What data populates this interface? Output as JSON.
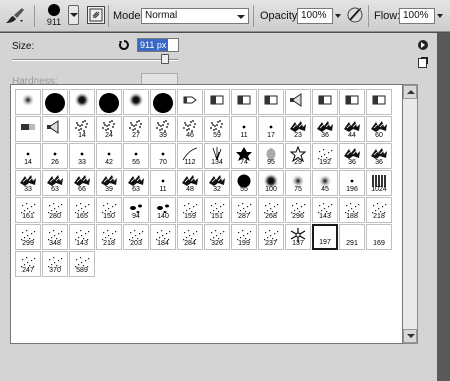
{
  "toolbar": {
    "brush_size": "911",
    "mode_label": "Mode:",
    "mode_value": "Normal",
    "opacity_label": "Opacity:",
    "opacity_value": "100%",
    "flow_label": "Flow:",
    "flow_value": "100%"
  },
  "panel": {
    "size_label": "Size:",
    "size_value": "911 px",
    "size_fraction": 0.92,
    "hardness_label": "Hardness:"
  },
  "brushes": [
    {
      "label": "",
      "glyph": "soft-dot-small"
    },
    {
      "label": "",
      "glyph": "hard-dot-large"
    },
    {
      "label": "",
      "glyph": "soft-dot-medium"
    },
    {
      "label": "",
      "glyph": "hard-dot-large"
    },
    {
      "label": "",
      "glyph": "soft-dot-medium"
    },
    {
      "label": "",
      "glyph": "hard-dot-large"
    },
    {
      "label": "",
      "glyph": "pencil-tip"
    },
    {
      "label": "",
      "glyph": "chisel-tip"
    },
    {
      "label": "",
      "glyph": "chisel-tip"
    },
    {
      "label": "",
      "glyph": "chisel-tip"
    },
    {
      "label": "",
      "glyph": "fan-tip"
    },
    {
      "label": "",
      "glyph": "chisel-tip"
    },
    {
      "label": "",
      "glyph": "chisel-tip"
    },
    {
      "label": "",
      "glyph": "chisel-tip"
    },
    {
      "label": "",
      "glyph": "chalk"
    },
    {
      "label": "",
      "glyph": "fan-tip"
    },
    {
      "label": "14",
      "glyph": "spray"
    },
    {
      "label": "24",
      "glyph": "spray"
    },
    {
      "label": "27",
      "glyph": "spray"
    },
    {
      "label": "39",
      "glyph": "spray"
    },
    {
      "label": "46",
      "glyph": "spray"
    },
    {
      "label": "59",
      "glyph": "spray"
    },
    {
      "label": "11",
      "glyph": "speck"
    },
    {
      "label": "17",
      "glyph": "speck"
    },
    {
      "label": "23",
      "glyph": "texture"
    },
    {
      "label": "36",
      "glyph": "texture"
    },
    {
      "label": "44",
      "glyph": "texture"
    },
    {
      "label": "60",
      "glyph": "texture"
    },
    {
      "label": "14",
      "glyph": "speck"
    },
    {
      "label": "26",
      "glyph": "speck"
    },
    {
      "label": "33",
      "glyph": "speck"
    },
    {
      "label": "42",
      "glyph": "speck"
    },
    {
      "label": "55",
      "glyph": "speck"
    },
    {
      "label": "70",
      "glyph": "speck"
    },
    {
      "label": "112",
      "glyph": "hairline"
    },
    {
      "label": "134",
      "glyph": "grass"
    },
    {
      "label": "74",
      "glyph": "leaf"
    },
    {
      "label": "95",
      "glyph": "leaf-gray"
    },
    {
      "label": "29",
      "glyph": "star"
    },
    {
      "label": "192",
      "glyph": "scatter"
    },
    {
      "label": "36",
      "glyph": "texture"
    },
    {
      "label": "36",
      "glyph": "texture"
    },
    {
      "label": "33",
      "glyph": "texture"
    },
    {
      "label": "63",
      "glyph": "texture"
    },
    {
      "label": "66",
      "glyph": "texture"
    },
    {
      "label": "39",
      "glyph": "texture"
    },
    {
      "label": "63",
      "glyph": "texture"
    },
    {
      "label": "11",
      "glyph": "speck"
    },
    {
      "label": "48",
      "glyph": "texture"
    },
    {
      "label": "32",
      "glyph": "texture"
    },
    {
      "label": "55",
      "glyph": "hard-dot-medium"
    },
    {
      "label": "100",
      "glyph": "soft-dot-medium"
    },
    {
      "label": "75",
      "glyph": "soft-dot-small"
    },
    {
      "label": "45",
      "glyph": "soft-dot-small"
    },
    {
      "label": "196",
      "glyph": "speck"
    },
    {
      "label": "1024",
      "glyph": "bristles"
    },
    {
      "label": "161",
      "glyph": "scatter"
    },
    {
      "label": "280",
      "glyph": "scatter"
    },
    {
      "label": "165",
      "glyph": "scatter"
    },
    {
      "label": "150",
      "glyph": "scatter"
    },
    {
      "label": "94",
      "glyph": "blob"
    },
    {
      "label": "140",
      "glyph": "blob"
    },
    {
      "label": "159",
      "glyph": "scatter"
    },
    {
      "label": "151",
      "glyph": "scatter"
    },
    {
      "label": "287",
      "glyph": "scatter"
    },
    {
      "label": "268",
      "glyph": "scatter"
    },
    {
      "label": "296",
      "glyph": "scatter"
    },
    {
      "label": "143",
      "glyph": "scatter"
    },
    {
      "label": "188",
      "glyph": "scatter"
    },
    {
      "label": "218",
      "glyph": "scatter"
    },
    {
      "label": "299",
      "glyph": "scatter"
    },
    {
      "label": "348",
      "glyph": "scatter"
    },
    {
      "label": "143",
      "glyph": "scatter"
    },
    {
      "label": "218",
      "glyph": "scatter"
    },
    {
      "label": "203",
      "glyph": "scatter"
    },
    {
      "label": "184",
      "glyph": "scatter"
    },
    {
      "label": "284",
      "glyph": "scatter"
    },
    {
      "label": "326",
      "glyph": "scatter"
    },
    {
      "label": "199",
      "glyph": "scatter"
    },
    {
      "label": "237",
      "glyph": "scatter"
    },
    {
      "label": "137",
      "glyph": "snowflake"
    },
    {
      "label": "197",
      "glyph": "blank",
      "selected": true
    },
    {
      "label": "291",
      "glyph": "blank"
    },
    {
      "label": "169",
      "glyph": "blank"
    },
    {
      "label": "247",
      "glyph": "scatter"
    },
    {
      "label": "370",
      "glyph": "scatter"
    },
    {
      "label": "589",
      "glyph": "scatter"
    }
  ]
}
